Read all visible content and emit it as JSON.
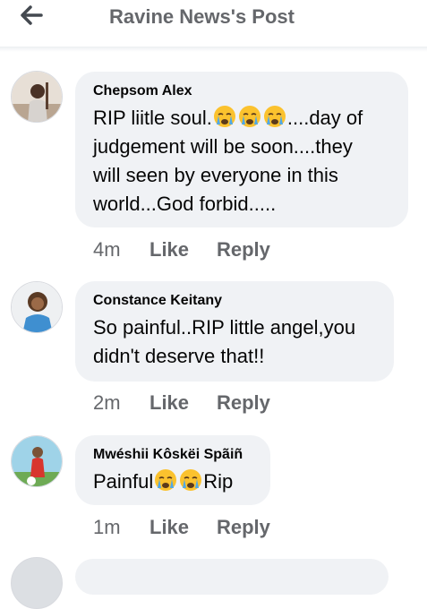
{
  "header": {
    "title": "Ravine News's Post",
    "back_icon": "arrow-left-icon"
  },
  "comments": [
    {
      "author": "Chepsom Alex",
      "text_before": "RIP liitle soul.",
      "emoji_count": 3,
      "text_after": "....day of\njudgement will be soon....they\nwill seen by everyone in this\nworld...God forbid.....",
      "time": "4m",
      "like": "Like",
      "reply": "Reply"
    },
    {
      "author": "Constance Keitany",
      "text_before": "So painful..RIP little angel,you\ndidn't deserve that!!",
      "emoji_count": 0,
      "text_after": "",
      "time": "2m",
      "like": "Like",
      "reply": "Reply"
    },
    {
      "author": "Mwéshii Kôskëi Spãiñ",
      "text_before": "Painful",
      "emoji_count": 2,
      "text_after": "Rip",
      "time": "1m",
      "like": "Like",
      "reply": "Reply"
    }
  ],
  "colors": {
    "bubble": "#f0f2f5",
    "meta_text": "#65676b",
    "emoji_face": "#fbc22e",
    "emoji_tears": "#4fa8e8"
  }
}
